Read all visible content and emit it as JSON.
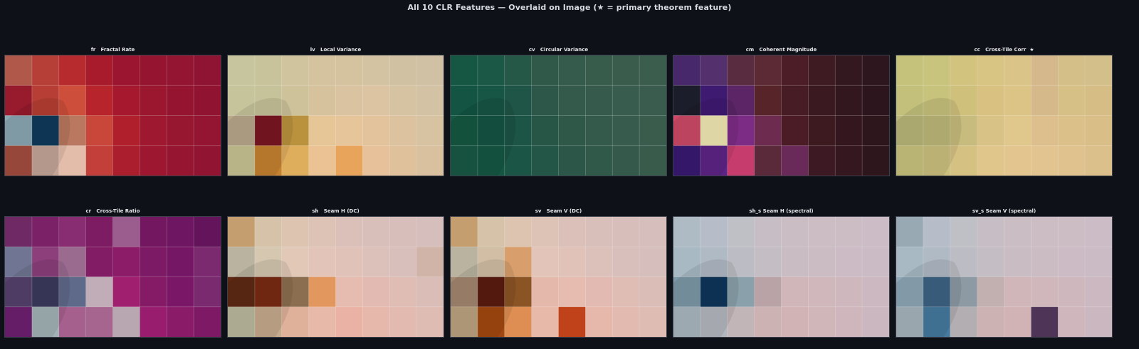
{
  "figure": {
    "title": "All 10 CLR Features — Overlaid on Image  (★ = primary theorem feature)"
  },
  "chart_data": [
    {
      "type": "heatmap",
      "title": "fr   Fractal Rate",
      "colors": [
        [
          "#b0594a",
          "#b64038",
          "#b72b2f",
          "#a81b2c",
          "#9b1530",
          "#951530",
          "#931531",
          "#8f1332"
        ],
        [
          "#971b2d",
          "#b73e34",
          "#cd4e3a",
          "#b7242b",
          "#a5182d",
          "#9a172f",
          "#951531",
          "#911332"
        ],
        [
          "#8ba8b3",
          "#113a5c",
          "#b9785f",
          "#c9463a",
          "#af1f2c",
          "#9e1830",
          "#971630",
          "#931532"
        ],
        [
          "#a34e3e",
          "#c4a598",
          "#e3bcaa",
          "#c3403a",
          "#ab1e2e",
          "#9d1730",
          "#961531",
          "#911432"
        ]
      ]
    },
    {
      "type": "heatmap",
      "title": "lv   Local Variance",
      "colors": [
        [
          "#c6c59d",
          "#c8c39b",
          "#d0c49e",
          "#d4c39e",
          "#d5c29f",
          "#d3c3a2",
          "#d1c1a3",
          "#d0c0a4"
        ],
        [
          "#c6c49b",
          "#c6c39a",
          "#cec29b",
          "#d6c29d",
          "#dac3a0",
          "#dcc3a1",
          "#d6c3a2",
          "#d3c2a4"
        ],
        [
          "#b9a88a",
          "#7a1722",
          "#ba923e",
          "#e6c697",
          "#e6c59a",
          "#e2c39c",
          "#dcc29f",
          "#d7c2a2"
        ],
        [
          "#c9c494",
          "#c5822f",
          "#dfae5d",
          "#ebc293",
          "#e9a45b",
          "#e6c199",
          "#dfc19c",
          "#d9c19f"
        ]
      ]
    },
    {
      "type": "heatmap",
      "title": "cv   Circular Variance",
      "colors": [
        [
          "#155743",
          "#1c5846",
          "#265847",
          "#305949",
          "#345b4b",
          "#385c4c",
          "#3a5c4d",
          "#3b5d4e"
        ],
        [
          "#135443",
          "#175544",
          "#1f5546",
          "#2d5748",
          "#335a4b",
          "#365b4c",
          "#385c4d",
          "#3a5c4e"
        ],
        [
          "#165843",
          "#145444",
          "#1c5445",
          "#275647",
          "#2f5849",
          "#345a4b",
          "#375b4c",
          "#395c4d"
        ],
        [
          "#185a45",
          "#165744",
          "#1a5545",
          "#235646",
          "#2c5748",
          "#31594a",
          "#355a4b",
          "#385b4c"
        ]
      ]
    },
    {
      "type": "heatmap",
      "title": "cm   Coherent Magnitude",
      "colors": [
        [
          "#47296b",
          "#54306c",
          "#5a2c3f",
          "#5c2a35",
          "#4c1d26",
          "#3e1a22",
          "#331820",
          "#2d161d"
        ],
        [
          "#1c1d2a",
          "#3f1a71",
          "#5b2566",
          "#572529",
          "#481c24",
          "#3b1920",
          "#33171e",
          "#2c151c"
        ],
        [
          "#ce4a68",
          "#f1eab4",
          "#7d2c86",
          "#6d2b50",
          "#4b1c26",
          "#3d1920",
          "#34171e",
          "#2e161d"
        ],
        [
          "#3a1a73",
          "#5d2486",
          "#c63d6d",
          "#5b2a3a",
          "#6a2a59",
          "#3d1a23",
          "#35171f",
          "#2e161d"
        ]
      ]
    },
    {
      "type": "heatmap",
      "title": "cc   Cross-Tile Corr  ★",
      "colors": [
        [
          "#c5c27b",
          "#c9c47d",
          "#d2c37f",
          "#d8c483",
          "#dac487",
          "#d5b98c",
          "#d4bf89",
          "#d3bf8a"
        ],
        [
          "#c2c07b",
          "#c7c27c",
          "#cfc07c",
          "#d9c281",
          "#dcc486",
          "#d5b98b",
          "#d6c086",
          "#d6bd85"
        ],
        [
          "#b9b779",
          "#bdb979",
          "#c7bc7d",
          "#d9c285",
          "#e0c78b",
          "#dcbf8c",
          "#dbc089",
          "#d9be88"
        ],
        [
          "#c9c47d",
          "#cbc07e",
          "#d5c283",
          "#e0c68b",
          "#e3c68f",
          "#e2c490",
          "#dfc28e",
          "#dcc08c"
        ]
      ]
    },
    {
      "type": "heatmap",
      "title": "cr   Cross-Tile Ratio",
      "colors": [
        [
          "#6f2a66",
          "#7b2168",
          "#892d72",
          "#7d1b63",
          "#9b5c8e",
          "#741761",
          "#6e1661",
          "#63145a"
        ],
        [
          "#6f7592",
          "#8d3f7b",
          "#9a6a8f",
          "#821c65",
          "#8c1c68",
          "#7d1a66",
          "#761766",
          "#7c2a6f"
        ],
        [
          "#55426d",
          "#3c3a5d",
          "#5f6a8a",
          "#c1adb8",
          "#a0206f",
          "#851b67",
          "#7a1766",
          "#7a2b6f"
        ],
        [
          "#6e2070",
          "#a1b2b6",
          "#a5608e",
          "#a6658e",
          "#b8a7b0",
          "#991d6f",
          "#8a1b69",
          "#7e1966"
        ]
      ]
    },
    {
      "type": "heatmap",
      "title": "sh   Seam H (DC)",
      "colors": [
        [
          "#c59e6f",
          "#d5c2a8",
          "#dcc4b0",
          "#dcc3b5",
          "#dac0b8",
          "#d8bfba",
          "#d7bebb",
          "#d5bebc"
        ],
        [
          "#b9b39f",
          "#d5c7b0",
          "#e1c8b7",
          "#e2c5b8",
          "#e0c2b9",
          "#dcc0ba",
          "#d9bfbb",
          "#d0b4a8"
        ],
        [
          "#5e2a14",
          "#7a2b14",
          "#8b6e50",
          "#e2975e",
          "#e6bcb0",
          "#e3bab1",
          "#dfbcb4",
          "#dbbdb8"
        ],
        [
          "#bcb99f",
          "#c6ab8c",
          "#dfb09a",
          "#e7b9a8",
          "#e9b2a4",
          "#e6b7ab",
          "#e2baaf",
          "#dfbcb3"
        ]
      ]
    },
    {
      "type": "heatmap",
      "title": "sv   Seam V (DC)",
      "colors": [
        [
          "#c59e6f",
          "#d5c2a8",
          "#dcc4b0",
          "#dcc3b5",
          "#dac0b8",
          "#d8bfba",
          "#d7bebb",
          "#d5bebc"
        ],
        [
          "#b9b39f",
          "#d2bea4",
          "#d89f6c",
          "#e2c5b8",
          "#e0c2b9",
          "#dcc0ba",
          "#d9bfbb",
          "#d5bebc"
        ],
        [
          "#a3876f",
          "#5c1c10",
          "#8a5424",
          "#e4b8aa",
          "#e6bcb0",
          "#e3bab1",
          "#dfbcb4",
          "#dbbdb8"
        ],
        [
          "#bca37f",
          "#a34811",
          "#de8e52",
          "#e7b9a8",
          "#c0421a",
          "#e6b7ab",
          "#e2baaf",
          "#dfbcb3"
        ]
      ]
    },
    {
      "type": "heatmap",
      "title": "sh_s Seam H (spectral)",
      "colors": [
        [
          "#aebbc4",
          "#b6bdc8",
          "#bfbfc6",
          "#c6bec4",
          "#cabdc3",
          "#ccbcc3",
          "#ccbcc4",
          "#cbbcc5"
        ],
        [
          "#a8b9c4",
          "#b0bac5",
          "#bcbcc4",
          "#c4bec4",
          "#c9bcc3",
          "#cbbbc3",
          "#ccbbc4",
          "#cbbbc5"
        ],
        [
          "#7d98a8",
          "#0f365a",
          "#8aa0ab",
          "#b9a3a6",
          "#d0b6b9",
          "#cfb7bc",
          "#ceb8be",
          "#ccb8c0"
        ],
        [
          "#aab8c0",
          "#b3b7bd",
          "#c2b5b8",
          "#cdb2b3",
          "#d1b3b6",
          "#d0b5b9",
          "#ceb6bc",
          "#cbb7bf"
        ]
      ]
    },
    {
      "type": "heatmap",
      "title": "sv_s Seam V (spectral)",
      "colors": [
        [
          "#98a9b4",
          "#b6bdc8",
          "#bfbfc6",
          "#c6bec4",
          "#cabdc3",
          "#ccbcc3",
          "#ccbcc4",
          "#cbbcc5"
        ],
        [
          "#a8b9c4",
          "#b0bac5",
          "#bcbcc4",
          "#c4bec4",
          "#c9bcc3",
          "#cbbbc3",
          "#ccbbc4",
          "#cbbbc5"
        ],
        [
          "#8ea8b6",
          "#3d6384",
          "#8d9aa3",
          "#c2b0b1",
          "#d0b6b9",
          "#cfb7bc",
          "#ceb8be",
          "#ccb8c0"
        ],
        [
          "#a8b5bd",
          "#467a9e",
          "#b2aeb2",
          "#cdb2b3",
          "#d1b3b6",
          "#4e3456",
          "#ceb6bc",
          "#cbb7bf"
        ]
      ]
    }
  ]
}
